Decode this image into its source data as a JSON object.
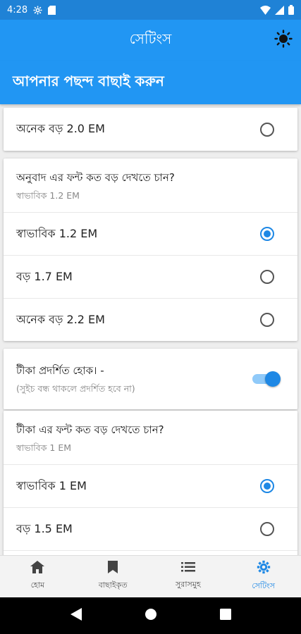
{
  "status_bar": {
    "time": "4:28"
  },
  "app_bar": {
    "title": "সেটিংস"
  },
  "banner": {
    "text": "আপনার পছন্দ বাছাই করুন"
  },
  "card1": {
    "option": "অনেক বড় 2.0 EM"
  },
  "translation_font": {
    "question": "অনুবাদ এর ফন্ট কত বড় দেখতে চান?",
    "current": "স্বাভাবিক 1.2 EM",
    "options": [
      {
        "label": "স্বাভাবিক 1.2 EM",
        "selected": true
      },
      {
        "label": "বড় 1.7 EM",
        "selected": false
      },
      {
        "label": "অনেক বড় 2.2 EM",
        "selected": false
      }
    ]
  },
  "tika_toggle": {
    "title": "টীকা প্রদর্শিত হোক। -",
    "subtitle": "(সুইচ বন্ধ থাকলে প্রদর্শিত হবে না)",
    "on": true
  },
  "tika_font": {
    "question": "টীকা এর ফন্ট কত বড় দেখতে চান?",
    "current": "স্বাভাবিক 1 EM",
    "options": [
      {
        "label": "স্বাভাবিক 1 EM",
        "selected": true
      },
      {
        "label": "বড় 1.5 EM",
        "selected": false
      }
    ]
  },
  "bottom_nav": {
    "items": [
      {
        "label": "হোম",
        "icon": "home-icon"
      },
      {
        "label": "বাছাইকৃত",
        "icon": "bookmark-icon"
      },
      {
        "label": "সুরাসমুহ",
        "icon": "list-icon"
      },
      {
        "label": "সেটিংস",
        "icon": "gear-icon",
        "active": true
      }
    ]
  },
  "colors": {
    "primary": "#2196f3",
    "status": "#1f82d6",
    "accent": "#1e88e5"
  }
}
